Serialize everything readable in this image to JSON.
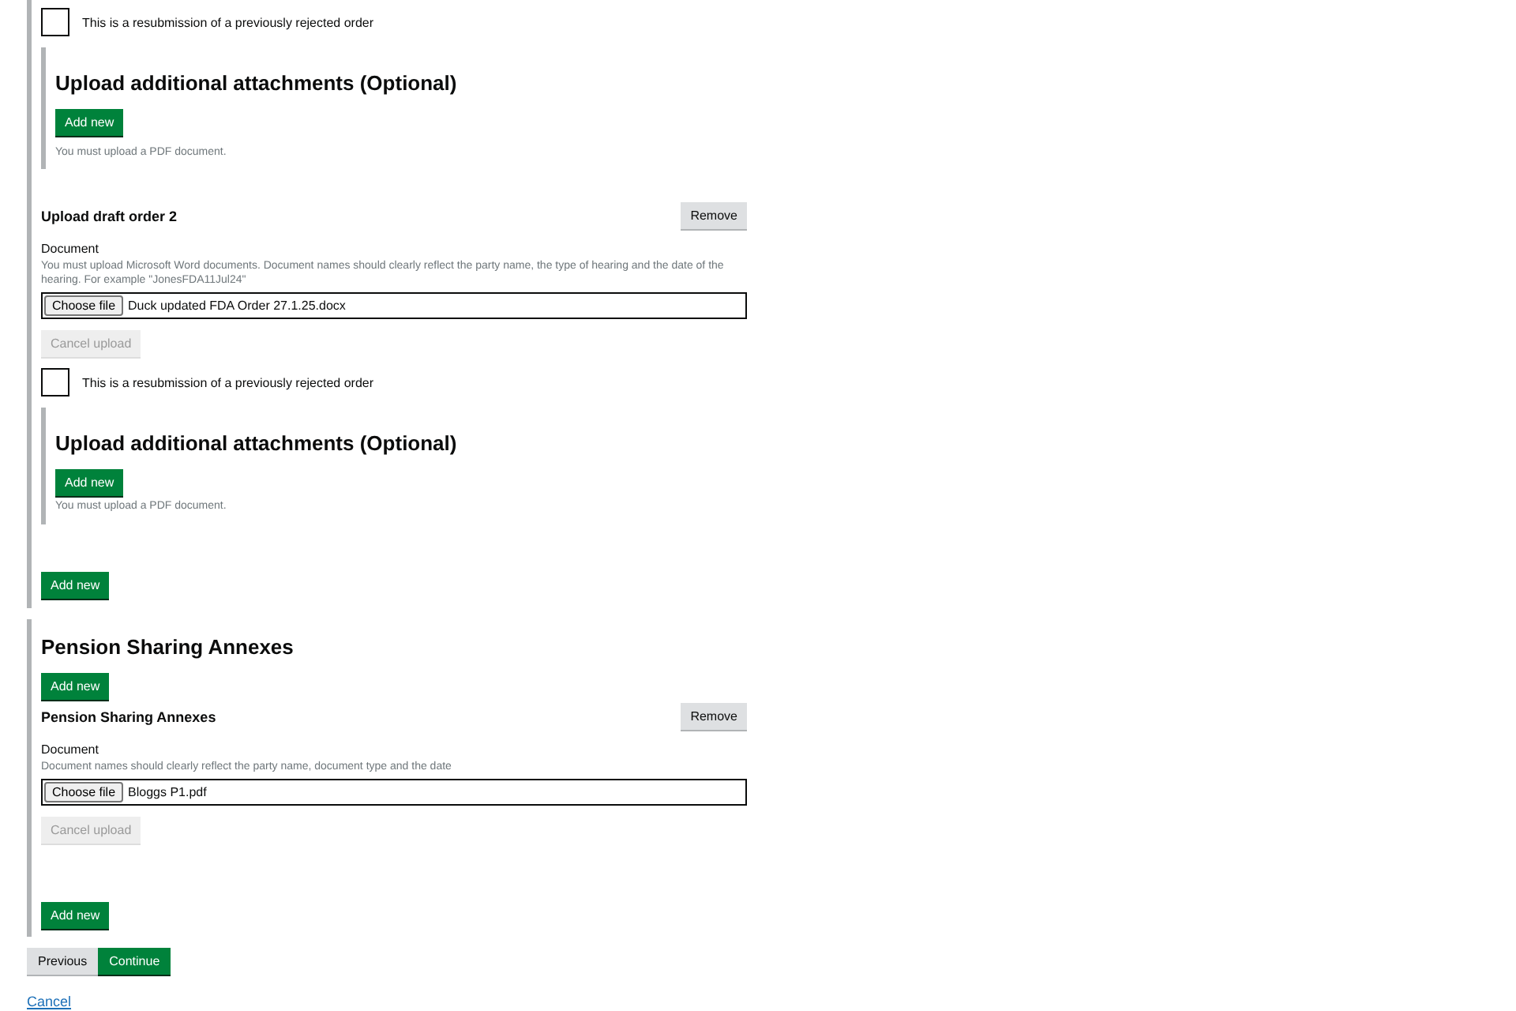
{
  "draft_orders": {
    "top_fragment": {
      "resubmission": {
        "label": "This is a resubmission of a previously rejected order",
        "checked": false
      },
      "attachments": {
        "heading": "Upload additional attachments (Optional)",
        "add_button": "Add new",
        "hint": "You must upload a PDF document."
      }
    },
    "items": [
      {
        "title": "Upload draft order 2",
        "remove_button": "Remove",
        "document_label": "Document",
        "hint": "You must upload Microsoft Word documents. Document names should clearly reflect the party name, the type of hearing and the date of the hearing. For example \"JonesFDA11Jul24\"",
        "file_button": "Choose file",
        "file_name": "Duck updated FDA Order 27.1.25.docx",
        "cancel_upload": {
          "label": "Cancel upload",
          "disabled": true
        },
        "resubmission": {
          "label": "This is a resubmission of a previously rejected order",
          "checked": false
        },
        "attachments": {
          "heading": "Upload additional attachments (Optional)",
          "add_button": "Add new",
          "hint": "You must upload a PDF document."
        }
      }
    ],
    "add_button": "Add new"
  },
  "pension_sharing": {
    "heading": "Pension Sharing Annexes",
    "add_button_top": "Add new",
    "items": [
      {
        "title": "Pension Sharing Annexes",
        "remove_button": "Remove",
        "document_label": "Document",
        "hint": "Document names should clearly reflect the party name, document type and the date",
        "file_button": "Choose file",
        "file_name": "Bloggs P1.pdf",
        "cancel_upload": {
          "label": "Cancel upload",
          "disabled": true
        }
      }
    ],
    "add_button": "Add new"
  },
  "navigation": {
    "previous": "Previous",
    "continue": "Continue",
    "cancel_link": "Cancel"
  }
}
